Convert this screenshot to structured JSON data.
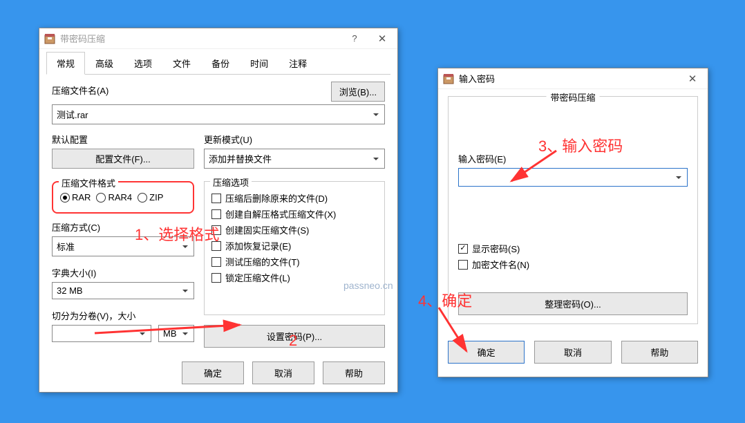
{
  "main": {
    "title": "带密码压缩",
    "tabs": [
      "常规",
      "高级",
      "选项",
      "文件",
      "备份",
      "时间",
      "注释"
    ],
    "filename_label": "压缩文件名(A)",
    "browse_btn": "浏览(B)...",
    "filename_value": "测试.rar",
    "default_profile_label": "默认配置",
    "profile_btn": "配置文件(F)...",
    "update_mode_label": "更新模式(U)",
    "update_mode_value": "添加并替换文件",
    "format_legend": "压缩文件格式",
    "formats": [
      "RAR",
      "RAR4",
      "ZIP"
    ],
    "method_label": "压缩方式(C)",
    "method_value": "标准",
    "dict_label": "字典大小(I)",
    "dict_value": "32 MB",
    "split_label": "切分为分卷(V)，大小",
    "split_unit": "MB",
    "options_legend": "压缩选项",
    "options": [
      "压缩后删除原来的文件(D)",
      "创建自解压格式压缩文件(X)",
      "创建固实压缩文件(S)",
      "添加恢复记录(E)",
      "测试压缩的文件(T)",
      "锁定压缩文件(L)"
    ],
    "set_password_btn": "设置密码(P)...",
    "ok": "确定",
    "cancel": "取消",
    "help": "帮助"
  },
  "pwd": {
    "title": "输入密码",
    "group_legend": "带密码压缩",
    "input_label": "输入密码(E)",
    "show_pwd": "显示密码(S)",
    "encrypt_names": "加密文件名(N)",
    "organize_btn": "整理密码(O)...",
    "ok": "确定",
    "cancel": "取消",
    "help": "帮助"
  },
  "ann": {
    "step1": "1、选择格式",
    "step2": "2",
    "step3": "3、输入密码",
    "step4": "4、确定"
  },
  "watermark": "passneo.cn"
}
